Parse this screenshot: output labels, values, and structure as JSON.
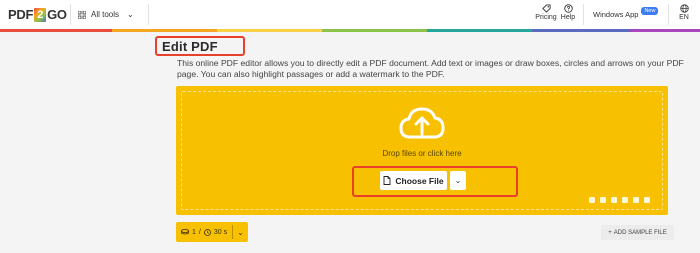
{
  "header": {
    "logo": {
      "part1": "PDF",
      "part2": "2",
      "part3": "GO"
    },
    "all_tools_label": "All tools",
    "pricing_label": "Pricing",
    "help_label": "Help",
    "windows_app_label": "Windows App",
    "new_badge": "New",
    "language_label": "EN"
  },
  "main": {
    "title": "Edit PDF",
    "description": "This online PDF editor allows you to directly edit a PDF document. Add text or images or draw boxes, circles and arrows on your PDF page. You can also highlight passages or add a watermark to the PDF.",
    "dropzone": {
      "drop_text": "Drop files or click here",
      "choose_file_label": "Choose File"
    },
    "limits": {
      "files": "1",
      "separator": "/",
      "time": "30 s"
    },
    "add_sample_label": "ADD SAMPLE FILE"
  },
  "icons": {
    "upload": "cloud-upload-icon",
    "sources": [
      "folder-icon",
      "link-icon",
      "google-drive-icon",
      "cloud-icon",
      "dropbox-icon",
      "copy-icon"
    ]
  },
  "colors": {
    "accent_yellow": "#f7c000",
    "highlight_red": "#e8402b",
    "badge_blue": "#3d7cf2"
  }
}
